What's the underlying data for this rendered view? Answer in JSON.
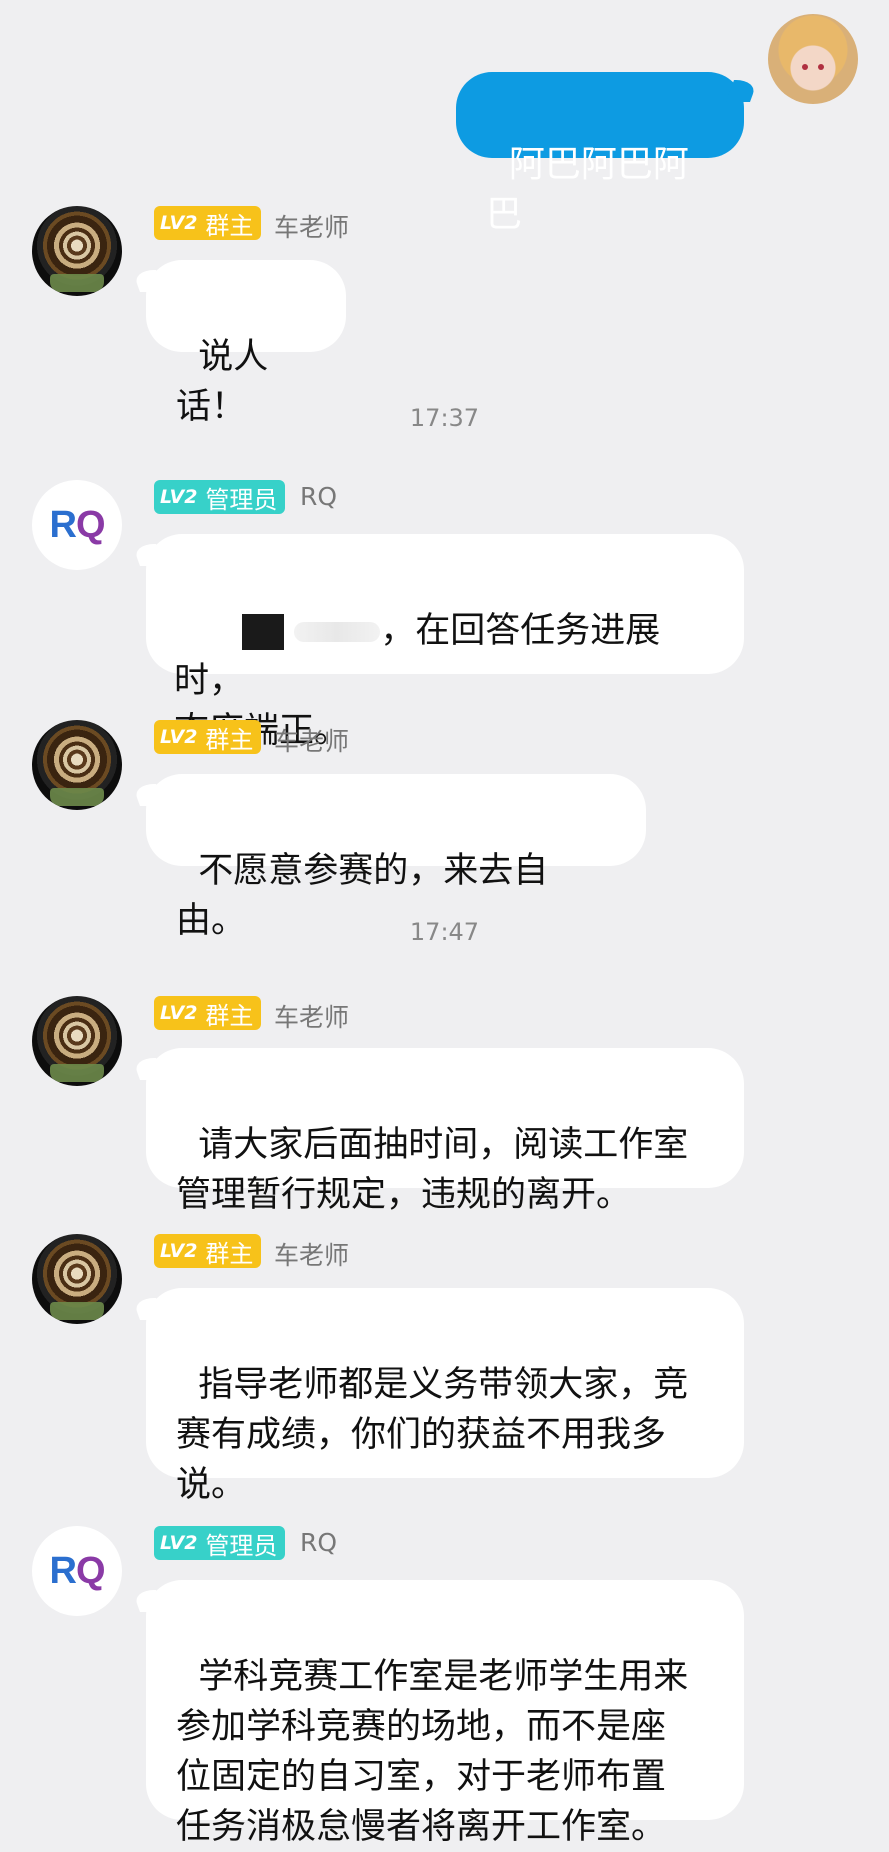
{
  "me": {
    "message": "阿巴阿巴阿巴"
  },
  "badges": {
    "level": "LV2",
    "owner": "群主",
    "admin": "管理员"
  },
  "times": [
    "17:37",
    "17:47"
  ],
  "messages": [
    {
      "sender": "车老师",
      "text": "说人话！"
    },
    {
      "sender": "RQ",
      "text": "，在回答任务进展时，\n态度端正。"
    },
    {
      "sender": "车老师",
      "text": "不愿意参赛的，来去自由。"
    },
    {
      "sender": "车老师",
      "text": "请大家后面抽时间，阅读工作室\n管理暂行规定，违规的离开。"
    },
    {
      "sender": "车老师",
      "text": "指导老师都是义务带领大家，竞\n赛有成绩，你们的获益不用我多\n说。"
    },
    {
      "sender": "RQ",
      "text": "学科竞赛工作室是老师学生用来\n参加学科竞赛的场地，而不是座\n位固定的自习室，对于老师布置\n任务消极怠慢者将离开工作室。"
    }
  ],
  "avatars": {
    "rq_initials_r": "R",
    "rq_initials_q": "Q"
  },
  "colors": {
    "me_bubble": "#0d9be2",
    "owner_badge": "#f7c21a",
    "admin_badge": "#37d1c9",
    "background": "#efeff1"
  }
}
